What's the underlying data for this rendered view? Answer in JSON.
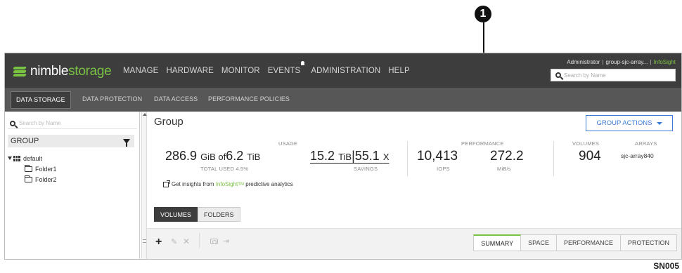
{
  "callout": {
    "number": "1"
  },
  "app": {
    "logo": {
      "part1": "nimble",
      "part2": "storage"
    },
    "nav": [
      "MANAGE",
      "HARDWARE",
      "MONITOR",
      "EVENTS",
      "ADMINISTRATION",
      "HELP"
    ],
    "user": {
      "name": "Administrator",
      "group": "group-sjc-array...",
      "infosight": "InfoSight"
    },
    "top_search_placeholder": "Search by Name",
    "subnav": [
      "DATA STORAGE",
      "DATA PROTECTION",
      "DATA ACCESS",
      "PERFORMANCE POLICIES"
    ],
    "colors": {
      "accent_green": "#79c143",
      "accent_blue": "#3a7bd5",
      "topbar": "#3d3d3d"
    }
  },
  "sidebar": {
    "search_placeholder": "Search by Name",
    "group_label": "GROUP",
    "tree": {
      "root": "default",
      "children": [
        "Folder1",
        "Folder2"
      ]
    }
  },
  "main": {
    "title": "Group",
    "actions_label": "GROUP ACTIONS",
    "usage": {
      "label": "USAGE",
      "used_num": "286.9",
      "used_unit": "GiB of",
      "total_num": "6.2",
      "total_unit": "TiB",
      "total_used_label": "TOTAL USED 4.5%"
    },
    "savings": {
      "value1_num": "15.2",
      "value1_unit": "TiB",
      "sep": "|",
      "value2": "55.1",
      "value2_unit": "X",
      "label": "SAVINGS"
    },
    "performance": {
      "label": "PERFORMANCE",
      "iops": "10,413",
      "iops_label": "IOPS",
      "mbs": "272.2",
      "mbs_label": "MiB/s"
    },
    "volumes": {
      "label": "VOLUMES",
      "value": "904"
    },
    "arrays": {
      "label": "ARRAYS",
      "value": "sjc-array840"
    },
    "insights": {
      "prefix": "Get insights from",
      "brand": "InfoSight",
      "tm": "TM",
      "suffix": "predictive analytics"
    },
    "view_tabs": [
      "VOLUMES",
      "FOLDERS"
    ],
    "bottom_tabs": [
      "SUMMARY",
      "SPACE",
      "PERFORMANCE",
      "PROTECTION"
    ]
  },
  "figure_code": "SN005"
}
